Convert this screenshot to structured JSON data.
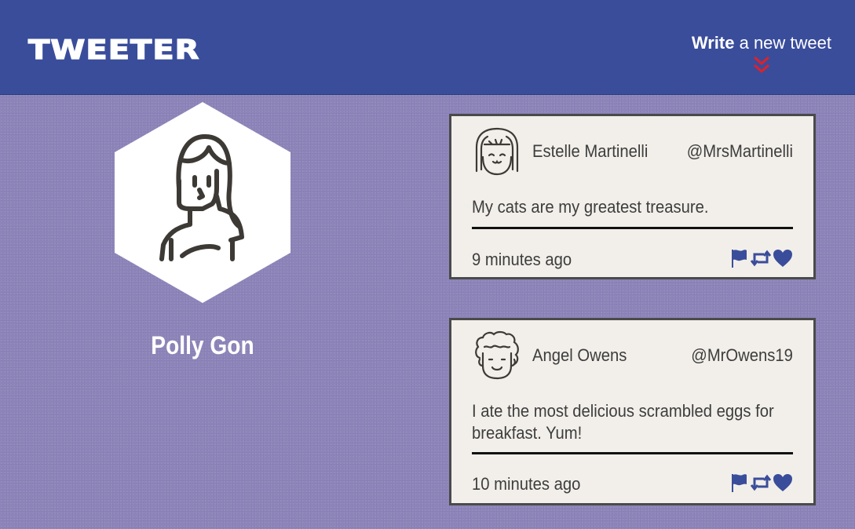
{
  "nav": {
    "logo": "TWEETER",
    "compose_bold": "Write",
    "compose_rest": " a new tweet",
    "compose_arrow_icon": "double-chevron-down-icon",
    "compose_arrow_color": "#e0202a"
  },
  "profile": {
    "name": "Polly Gon",
    "avatar_icon": "woman-avatar-icon"
  },
  "tweets": [
    {
      "name": "Estelle Martinelli",
      "handle": "@MrsMartinelli",
      "text": "My cats are my greatest treasure.",
      "time": "9 minutes ago",
      "avatar_icon": "girl-avatar-icon",
      "actions": [
        "flag-icon",
        "retweet-icon",
        "heart-icon"
      ]
    },
    {
      "name": "Angel Owens",
      "handle": "@MrOwens19",
      "text": "I ate the most delicious scrambled eggs for breakfast. Yum!",
      "time": "10 minutes ago",
      "avatar_icon": "curly-hair-avatar-icon",
      "actions": [
        "flag-icon",
        "retweet-icon",
        "heart-icon"
      ]
    }
  ],
  "colors": {
    "nav_bg": "#3a4d9b",
    "page_bg": "#8e86bb",
    "tweet_bg": "#f2efea",
    "action_icons": "#3a4d9b"
  }
}
